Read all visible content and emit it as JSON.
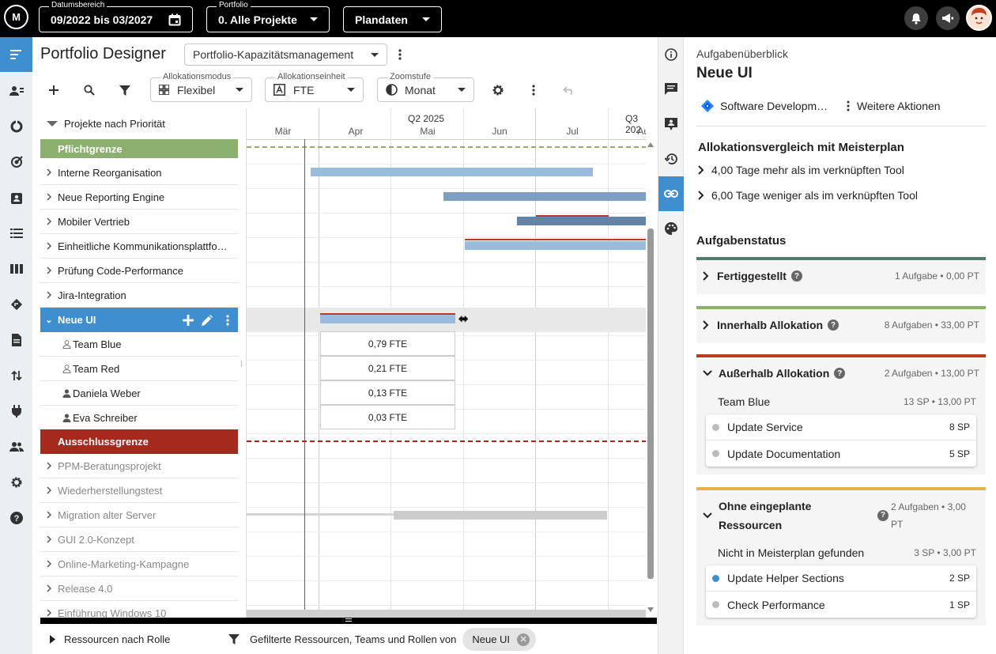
{
  "topbar": {
    "datumsbereich_label": "Datumsbereich",
    "datumsbereich_value": "09/2022 bis 03/2027",
    "portfolio_label": "Portfolio",
    "portfolio_value": "0. Alle Projekte",
    "plandaten_value": "Plandaten"
  },
  "header": {
    "title": "Portfolio Designer",
    "view_select": "Portfolio-Kapazitätsmanagement"
  },
  "toolbar": {
    "allokationsmodus_label": "Allokationsmodus",
    "allokationsmodus_value": "Flexibel",
    "allokationseinheit_label": "Allokationseinheit",
    "allokationseinheit_value": "FTE",
    "zoomstufe_label": "Zoomstufe",
    "zoomstufe_value": "Monat"
  },
  "tree": {
    "header": "Projekte nach Priorität",
    "pflicht": "Pflichtgrenze",
    "ausschluss": "Ausschlussgrenze",
    "projects_top": [
      "Interne Reorganisation",
      "Neue Reporting Engine",
      "Mobiler Vertrieb",
      "Einheitliche Kommunikationsplattfo…",
      "Prüfung Code-Performance",
      "Jira-Integration"
    ],
    "selected": "Neue UI",
    "resources": [
      {
        "name": "Team Blue",
        "fte": "0,79 FTE",
        "kind": "team"
      },
      {
        "name": "Team Red",
        "fte": "0,21 FTE",
        "kind": "team"
      },
      {
        "name": "Daniela Weber",
        "fte": "0,13 FTE",
        "kind": "person"
      },
      {
        "name": "Eva Schreiber",
        "fte": "0,03 FTE",
        "kind": "person"
      }
    ],
    "projects_bottom": [
      "PPM-Beratungsprojekt",
      "Wiederherstellungstest",
      "Migration alter Server",
      "GUI 2.0-Konzept",
      "Online-Marketing-Kampagne",
      "Release 4.0",
      "Einführung Windows 10"
    ]
  },
  "timeline": {
    "quarters": [
      "Q2 2025",
      "Q3 202"
    ],
    "months": [
      "Mär",
      "Apr",
      "Mai",
      "Jun",
      "Jul",
      "Aug"
    ]
  },
  "bottom": {
    "left": "Ressourcen nach Rolle",
    "filter_text": "Gefilterte Ressourcen, Teams und Rollen von",
    "chip": "Neue UI"
  },
  "panel": {
    "overline": "Aufgabenüberblick",
    "title": "Neue UI",
    "link": "Software Developm…",
    "more": "Weitere Aktionen",
    "vergleich_title": "Allokationsvergleich mit Meisterplan",
    "vergleich": [
      "4,00 Tage mehr als im verknüpften Tool",
      "6,00 Tage weniger als im verknüpften Tool"
    ],
    "status_title": "Aufgabenstatus",
    "fertig": {
      "name": "Fertiggestellt",
      "meta": "1 Aufgabe • 0,00 PT",
      "color": "#4e7d6b"
    },
    "innerhalb": {
      "name": "Innerhalb Allokation",
      "meta": "8 Aufgaben • 33,00 PT",
      "color": "#8cb06f"
    },
    "ausserhalb": {
      "name": "Außerhalb Allokation",
      "meta": "2 Aufgaben • 13,00 PT",
      "color": "#b93a25",
      "group": "Team Blue",
      "group_meta": "13 SP • 13,00 PT",
      "tasks": [
        {
          "name": "Update Service",
          "sp": "8 SP",
          "dot": "#bbbbbb"
        },
        {
          "name": "Update Documentation",
          "sp": "5 SP",
          "dot": "#bbbbbb"
        }
      ]
    },
    "ohne": {
      "name1": "Ohne eingeplante",
      "name2": "Ressourcen",
      "meta1": "2 Aufgaben • 3,00",
      "meta2": "PT",
      "color": "#e8b24a",
      "group": "Nicht in Meisterplan gefunden",
      "group_meta": "3 SP • 3,00 PT",
      "tasks": [
        {
          "name": "Update Helper Sections",
          "sp": "2 SP",
          "dot": "#3e8ed0"
        },
        {
          "name": "Check Performance",
          "sp": "1 SP",
          "dot": "#bbbbbb"
        }
      ]
    }
  }
}
